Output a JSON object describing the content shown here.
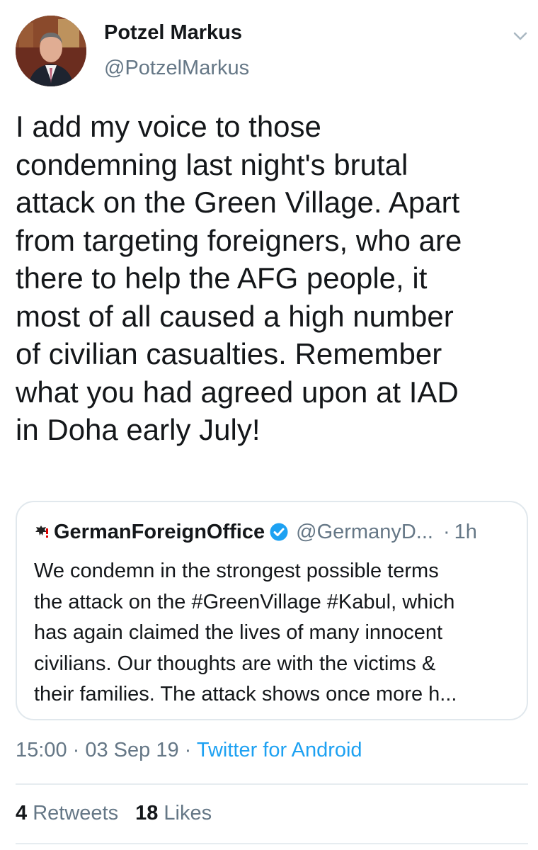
{
  "author": {
    "name": "Potzel Markus",
    "handle": "@PotzelMarkus",
    "avatar": "profile-photo"
  },
  "tweet": {
    "lines": [
      "I add my voice to those",
      "condemning last night's brutal",
      "attack on the Green Village. Apart",
      "from targeting foreigners, who are",
      "there to help the AFG people, it",
      "most of all caused a high number",
      "of civilian casualties. Remember",
      "what you had agreed upon at IAD",
      "in Doha early July!"
    ]
  },
  "quoted_tweet": {
    "name": "GermanForeignOffice",
    "handle": "@GermanyD...",
    "separator": "·",
    "time": "1h",
    "verified": true,
    "lines": [
      "We condemn in the strongest possible terms",
      "the attack on the #GreenVillage #Kabul, which",
      "has again claimed the lives of many innocent",
      "civilians. Our thoughts are with the victims &",
      "their families. The attack shows once more h..."
    ]
  },
  "meta": {
    "time": "15:00",
    "sep1": " · ",
    "date": "03 Sep 19",
    "sep2": " · ",
    "source": "Twitter for Android"
  },
  "stats": {
    "retweets_count": "4",
    "retweets_label": "Retweets",
    "likes_count": "18",
    "likes_label": "Likes"
  },
  "colors": {
    "primary_text": "#14171a",
    "secondary_text": "#657786",
    "link": "#1da1f2",
    "border": "#e1e8ed"
  }
}
